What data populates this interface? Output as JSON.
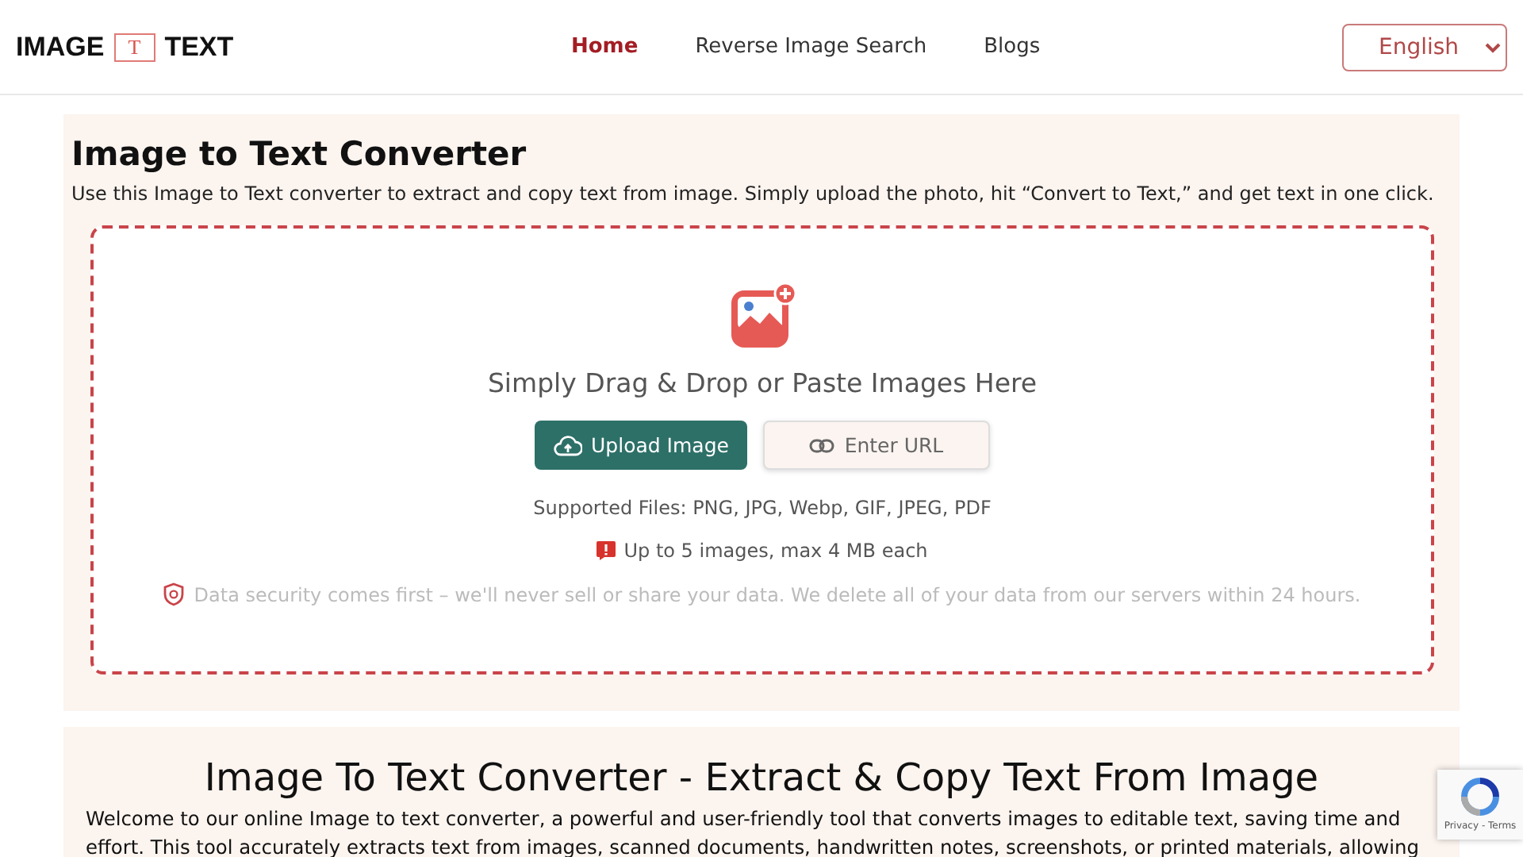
{
  "header": {
    "logo_left": "IMAGE",
    "logo_mark": "T",
    "logo_right": "TEXT",
    "nav": [
      {
        "label": "Home",
        "selected": true
      },
      {
        "label": "Reverse Image Search",
        "selected": false
      },
      {
        "label": "Blogs",
        "selected": false
      }
    ],
    "language": "English"
  },
  "tool": {
    "title": "Image to Text Converter",
    "description": "Use this Image to Text converter to extract and copy text from image. Simply upload the photo, hit “Convert to Text,” and get text in one click.",
    "drop_hint": "Simply Drag & Drop or Paste Images Here",
    "buttons": [
      {
        "kind": "upload",
        "label": "Upload Image"
      },
      {
        "kind": "url",
        "label": "Enter URL"
      }
    ],
    "supported": "Supported Files: PNG, JPG, Webp, GIF, JPEG, PDF",
    "limit": "Up to 5 images, max 4 MB each",
    "security": "Data security comes first – we'll never sell or share your data. We delete all of your data from our servers within 24 hours."
  },
  "article": {
    "title": "Image To Text Converter - Extract & Copy Text From Image",
    "paragraph": "Welcome to our online Image to text converter, a powerful and user-friendly tool that converts images to editable text, saving time and effort. This tool accurately extracts text from images, scanned documents, handwritten notes, screenshots, or printed materials, allowing"
  },
  "captcha": {
    "links": "Privacy - Terms"
  }
}
